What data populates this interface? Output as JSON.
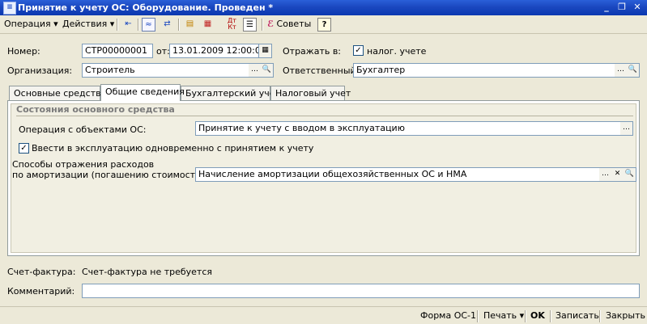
{
  "window": {
    "title": "Принятие к учету ОС: Оборудование. Проведен *",
    "icons": {
      "app": "document-icon",
      "minimize": "minimize-icon",
      "restore": "restore-icon",
      "close": "close-icon"
    }
  },
  "toolbar": {
    "operation": "Операция",
    "actions": "Действия",
    "advice": "Советы",
    "help": "?"
  },
  "header": {
    "number_label": "Номер:",
    "number_value": "СТР00000001",
    "date_label": "от:",
    "date_value": "13.01.2009 12:00:03",
    "reflect_label": "Отражать в:",
    "tax_label": "налог. учете",
    "tax_checked": true,
    "org_label": "Организация:",
    "org_value": "Строитель",
    "resp_label": "Ответственный:",
    "resp_value": "Бухгалтер"
  },
  "tabs": [
    {
      "label": "Основные средства",
      "active": false
    },
    {
      "label": "Общие сведения",
      "active": true
    },
    {
      "label": "Бухгалтерский учет",
      "active": false
    },
    {
      "label": "Налоговый учет",
      "active": false
    }
  ],
  "general": {
    "section_title": "Состояния основного средства",
    "op_label": "Операция с объектами ОС:",
    "op_value": "Принятие к учету с вводом в эксплуатацию",
    "commission_label": "Ввести в эксплуатацию одновременно с принятием к учету",
    "commission_checked": true,
    "expense_label_1": "Способы отражения расходов",
    "expense_label_2": "по амортизации (погашению стоимости):",
    "expense_value": "Начисление амортизации общехозяйственных ОС и НМА"
  },
  "footer": {
    "invoice_label": "Счет-фактура:",
    "invoice_value": "Счет-фактура не требуется",
    "comment_label": "Комментарий:",
    "comment_value": ""
  },
  "statusbar": {
    "form": "Форма ОС-1",
    "print": "Печать",
    "ok": "OK",
    "save": "Записать",
    "close": "Закрыть"
  }
}
